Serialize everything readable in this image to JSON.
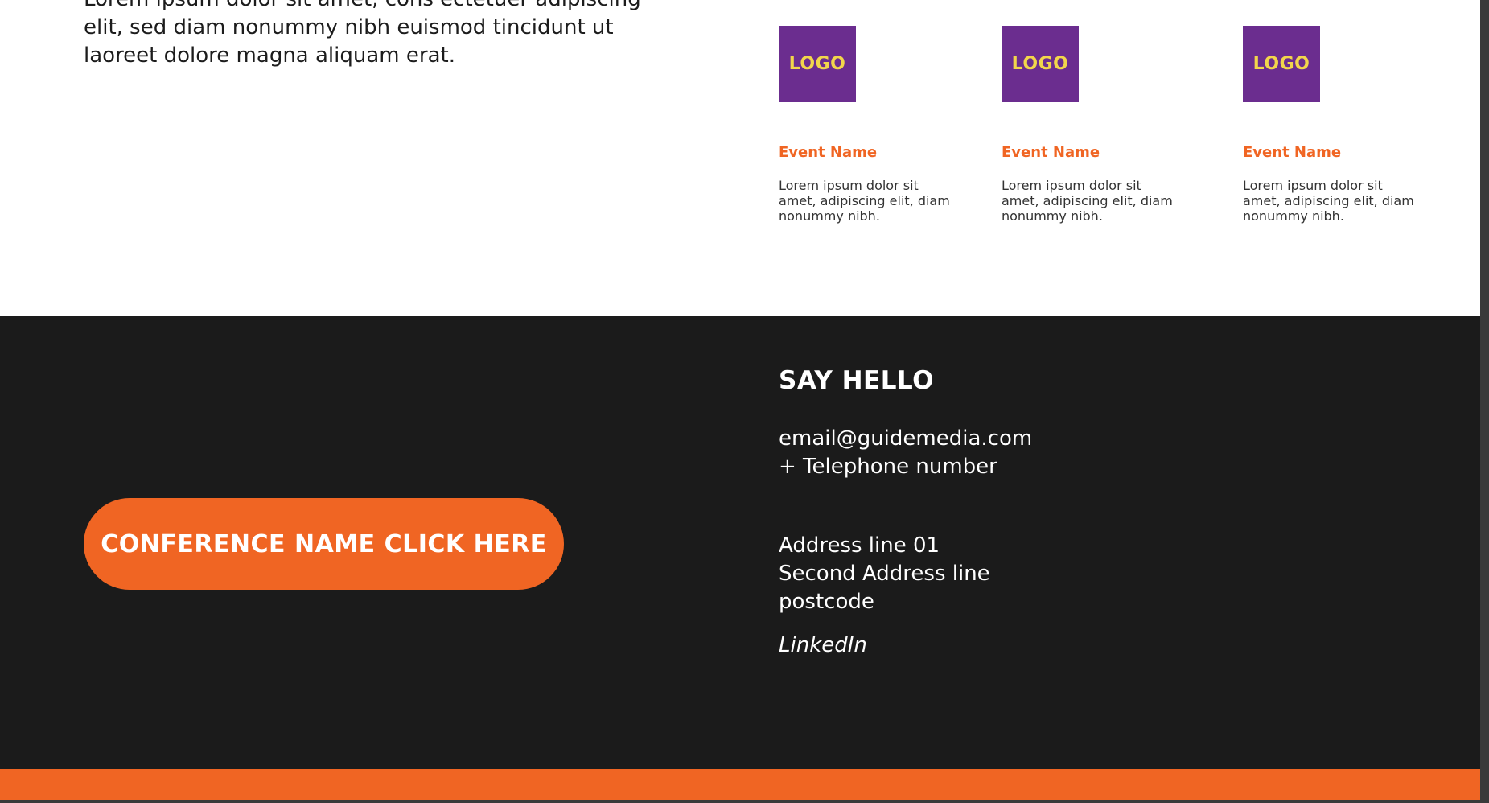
{
  "intro": {
    "text": "Lorem ipsum dolor sit amet, cons ectetuer adipiscing elit, sed diam nonummy nibh euismod tincidunt ut laoreet dolore magna aliquam erat."
  },
  "events": [
    {
      "logo": "LOGO",
      "name": "Event Name",
      "description": "Lorem ipsum dolor sit amet, adipiscing elit, diam nonummy nibh."
    },
    {
      "logo": "LOGO",
      "name": "Event Name",
      "description": "Lorem ipsum dolor sit amet, adipiscing elit, diam nonummy nibh."
    },
    {
      "logo": "LOGO",
      "name": "Event Name",
      "description": "Lorem ipsum dolor sit amet, adipiscing elit, diam nonummy nibh."
    }
  ],
  "footer": {
    "cta_label": "CONFERENCE NAME CLICK HERE",
    "heading": "SAY HELLO",
    "email": "email@guidemedia.com",
    "telephone": "+ Telephone number",
    "address_line_1": "Address line 01",
    "address_line_2": "Second Address line",
    "postcode": "postcode",
    "linkedin": "LinkedIn"
  },
  "colors": {
    "accent_orange": "#f06523",
    "logo_purple": "#6b2d8f",
    "logo_text_yellow": "#f2d64b",
    "footer_dark": "#1b1b1b"
  }
}
